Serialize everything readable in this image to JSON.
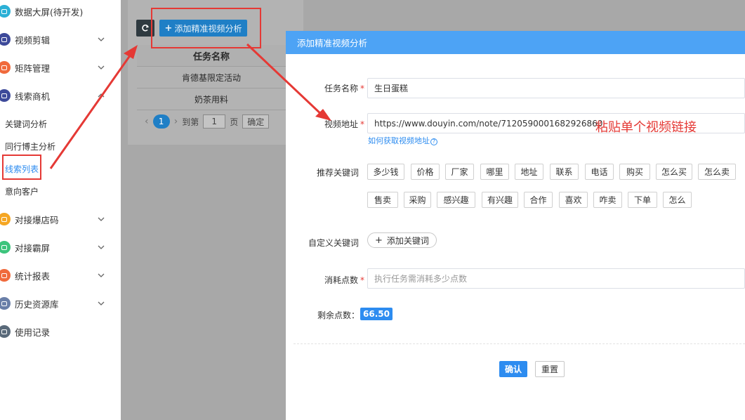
{
  "sidebar": {
    "items": [
      {
        "label": "数据大屏(待开发)",
        "color": "#2bb0d6",
        "chevron": false
      },
      {
        "label": "视频剪辑",
        "color": "#3d4a9a",
        "chevron": true
      },
      {
        "label": "矩阵管理",
        "color": "#f06a3c",
        "chevron": true
      },
      {
        "label": "线索商机",
        "color": "#3d4a9a",
        "chevron": true
      },
      {
        "label": "对接爆店码",
        "color": "#f5a623",
        "chevron": true
      },
      {
        "label": "对接霸屏",
        "color": "#3cc47c",
        "chevron": true
      },
      {
        "label": "统计报表",
        "color": "#f06a3c",
        "chevron": true
      },
      {
        "label": "历史资源库",
        "color": "#6a7fa8",
        "chevron": true
      },
      {
        "label": "使用记录",
        "color": "#5a6a7a",
        "chevron": false
      }
    ],
    "sub_items": [
      "关键词分析",
      "同行博主分析",
      "线索列表",
      "意向客户"
    ]
  },
  "toolbar": {
    "add_label": "添加精准视频分析"
  },
  "table": {
    "header": "任务名称",
    "rows": [
      "肯德基限定活动",
      "奶茶用料"
    ]
  },
  "pager": {
    "current": "1",
    "goto_label": "到第",
    "goto_value": "1",
    "page_label": "页",
    "confirm_label": "确定"
  },
  "modal": {
    "title": "添加精准视频分析",
    "task_name_label": "任务名称",
    "task_name_value": "生日蛋糕",
    "video_url_label": "视频地址",
    "video_url_value": "https://www.douyin.com/note/7120590001682926860",
    "help_link": "如何获取视频地址",
    "keywords_label": "推荐关键词",
    "keywords_row1": [
      "多少钱",
      "价格",
      "厂家",
      "哪里",
      "地址",
      "联系",
      "电话",
      "购买",
      "怎么买",
      "怎么卖"
    ],
    "keywords_row2": [
      "售卖",
      "采购",
      "感兴趣",
      "有兴趣",
      "合作",
      "喜欢",
      "咋卖",
      "下单",
      "怎么"
    ],
    "custom_kw_label": "自定义关键词",
    "add_kw_label": "添加关键词",
    "points_label": "消耗点数",
    "points_placeholder": "执行任务需消耗多少点数",
    "remaining_label": "剩余点数：",
    "remaining_value": "66.50",
    "confirm_btn": "确认",
    "reset_btn": "重置"
  },
  "annotation": {
    "text": "粘贴单个视频链接"
  },
  "colors": {
    "accent": "#2d8cf0",
    "header": "#4da3f5",
    "annotation": "#e53935"
  }
}
